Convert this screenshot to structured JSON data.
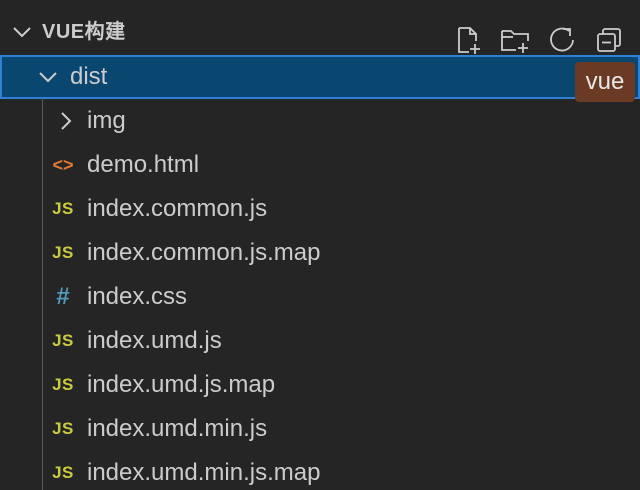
{
  "explorer": {
    "section_title": "VUE构建",
    "actions": {
      "new_file_icon": "new-file-icon",
      "new_folder_icon": "new-folder-icon",
      "refresh_icon": "refresh-icon",
      "collapse_icon": "collapse-all-icon"
    },
    "folder": {
      "name": "dist",
      "expanded": true,
      "selected": true
    },
    "tooltip": "vue",
    "children": [
      {
        "name": "img",
        "type": "folder",
        "icon": "chevron-right-icon"
      },
      {
        "name": "demo.html",
        "type": "html",
        "icon": "<>"
      },
      {
        "name": "index.common.js",
        "type": "js",
        "icon": "JS"
      },
      {
        "name": "index.common.js.map",
        "type": "js",
        "icon": "JS"
      },
      {
        "name": "index.css",
        "type": "css",
        "icon": "#"
      },
      {
        "name": "index.umd.js",
        "type": "js",
        "icon": "JS"
      },
      {
        "name": "index.umd.js.map",
        "type": "js",
        "icon": "JS"
      },
      {
        "name": "index.umd.min.js",
        "type": "js",
        "icon": "JS"
      },
      {
        "name": "index.umd.min.js.map",
        "type": "js",
        "icon": "JS"
      }
    ]
  },
  "colors": {
    "background": "#252526",
    "selection": "#094771",
    "selection_border": "#2f80d6",
    "js": "#cbcb41",
    "css": "#519aba",
    "html": "#e37933",
    "tooltip_bg": "#6b3a24"
  }
}
